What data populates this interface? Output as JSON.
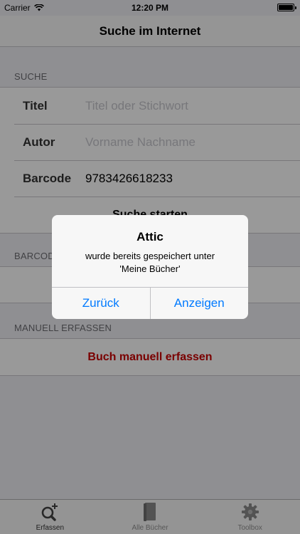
{
  "status_bar": {
    "carrier": "Carrier",
    "time": "12:20 PM"
  },
  "nav": {
    "title": "Suche im Internet"
  },
  "search_section": {
    "header": "SUCHE",
    "fields": [
      {
        "label": "Titel",
        "value": "",
        "placeholder": "Titel oder Stichwort"
      },
      {
        "label": "Autor",
        "value": "",
        "placeholder": "Vorname Nachname"
      },
      {
        "label": "Barcode",
        "value": "9783426618233",
        "placeholder": ""
      }
    ],
    "start_button": "Suche starten"
  },
  "barcode_section": {
    "header": "BARCODE"
  },
  "manual_section": {
    "header": "MANUELL ERFASSEN",
    "button": "Buch manuell erfassen"
  },
  "alert": {
    "title": "Attic",
    "message_line1": "wurde bereits gespeichert unter",
    "message_line2": "'Meine Bücher'",
    "back_button": "Zurück",
    "show_button": "Anzeigen"
  },
  "tabs": [
    {
      "label": "Erfassen",
      "icon": "search-add-icon"
    },
    {
      "label": "Alle Bücher",
      "icon": "book-icon"
    },
    {
      "label": "Toolbox",
      "icon": "gear-icon"
    }
  ],
  "colors": {
    "accent": "#007aff",
    "danger": "#cc0000"
  }
}
